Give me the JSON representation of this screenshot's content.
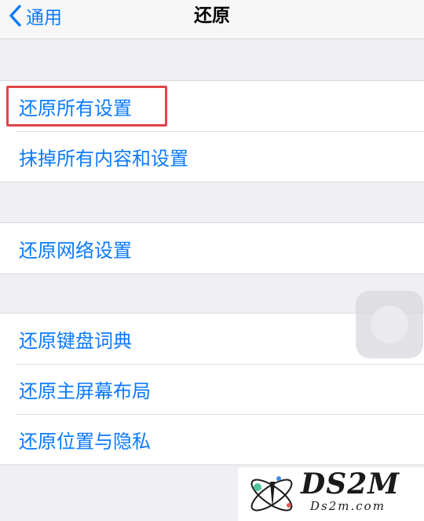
{
  "navbar": {
    "back_label": "通用",
    "title": "还原"
  },
  "groups": [
    {
      "items": [
        "还原所有设置",
        "抹掉所有内容和设置"
      ]
    },
    {
      "items": [
        "还原网络设置"
      ]
    },
    {
      "items": [
        "还原键盘词典",
        "还原主屏幕布局",
        "还原位置与隐私"
      ]
    }
  ],
  "highlighted_item": "还原所有设置",
  "highlight_color": "#e0444b",
  "accent_color": "#0a7aff",
  "watermark": {
    "brand": "DS2M",
    "domain": "Ds2m.com"
  }
}
